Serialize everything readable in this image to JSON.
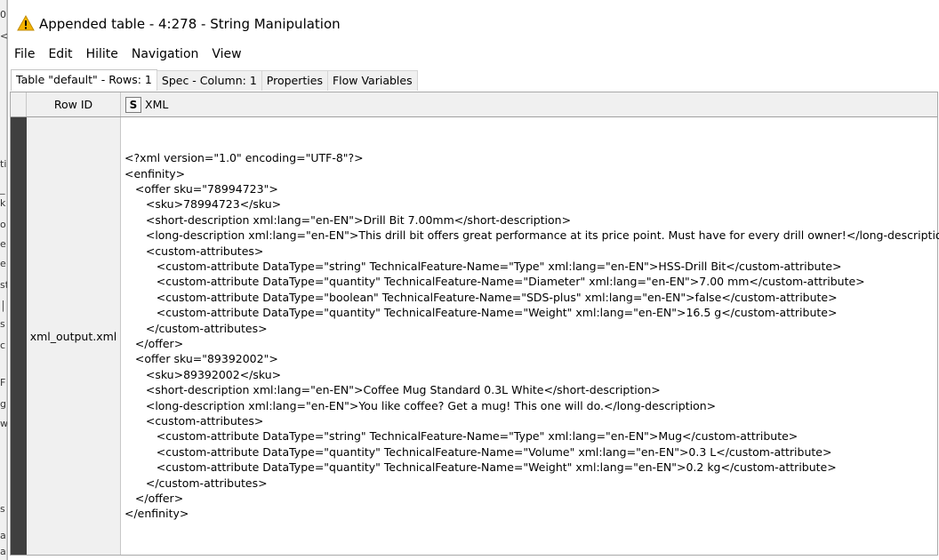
{
  "window": {
    "title": "Appended table - 4:278 - String Manipulation",
    "title_icon": "warning-triangle-icon"
  },
  "background_fragments": [
    "0",
    "<",
    "ti",
    "_",
    "k",
    "o",
    "e",
    "e",
    "st",
    "│",
    "s",
    "c",
    "F",
    "g",
    "w",
    "s",
    "a",
    "a"
  ],
  "menu": [
    "File",
    "Edit",
    "Hilite",
    "Navigation",
    "View"
  ],
  "tabs": [
    {
      "label": "Table \"default\" - Rows: 1",
      "active": true
    },
    {
      "label": "Spec - Column: 1",
      "active": false
    },
    {
      "label": "Properties",
      "active": false
    },
    {
      "label": "Flow Variables",
      "active": false
    }
  ],
  "table": {
    "headers": {
      "row_id": "Row ID",
      "column_type": "S",
      "column_name": "XML"
    },
    "rows": [
      {
        "row_id": "xml_output.xml",
        "xml_lines": [
          "<?xml version=\"1.0\" encoding=\"UTF-8\"?>",
          "<enfinity>",
          "   <offer sku=\"78994723\">",
          "      <sku>78994723</sku>",
          "      <short-description xml:lang=\"en-EN\">Drill Bit 7.00mm</short-description>",
          "      <long-description xml:lang=\"en-EN\">This drill bit offers great performance at its price point. Must have for every drill owner!</long-description>",
          "      <custom-attributes>",
          "         <custom-attribute DataType=\"string\" TechnicalFeature-Name=\"Type\" xml:lang=\"en-EN\">HSS-Drill Bit</custom-attribute>",
          "         <custom-attribute DataType=\"quantity\" TechnicalFeature-Name=\"Diameter\" xml:lang=\"en-EN\">7.00 mm</custom-attribute>",
          "         <custom-attribute DataType=\"boolean\" TechnicalFeature-Name=\"SDS-plus\" xml:lang=\"en-EN\">false</custom-attribute>",
          "         <custom-attribute DataType=\"quantity\" TechnicalFeature-Name=\"Weight\" xml:lang=\"en-EN\">16.5 g</custom-attribute>",
          "      </custom-attributes>",
          "   </offer>",
          "   <offer sku=\"89392002\">",
          "      <sku>89392002</sku>",
          "      <short-description xml:lang=\"en-EN\">Coffee Mug Standard 0.3L White</short-description>",
          "      <long-description xml:lang=\"en-EN\">You like coffee? Get a mug! This one will do.</long-description>",
          "      <custom-attributes>",
          "         <custom-attribute DataType=\"string\" TechnicalFeature-Name=\"Type\" xml:lang=\"en-EN\">Mug</custom-attribute>",
          "         <custom-attribute DataType=\"quantity\" TechnicalFeature-Name=\"Volume\" xml:lang=\"en-EN\">0.3 L</custom-attribute>",
          "         <custom-attribute DataType=\"quantity\" TechnicalFeature-Name=\"Weight\" xml:lang=\"en-EN\">0.2 kg</custom-attribute>",
          "      </custom-attributes>",
          "   </offer>",
          "</enfinity>"
        ]
      }
    ]
  },
  "colors": {
    "warning": "#f5b400",
    "selection_bar": "#3f3f3f",
    "header_bg": "#f0f0f0"
  }
}
